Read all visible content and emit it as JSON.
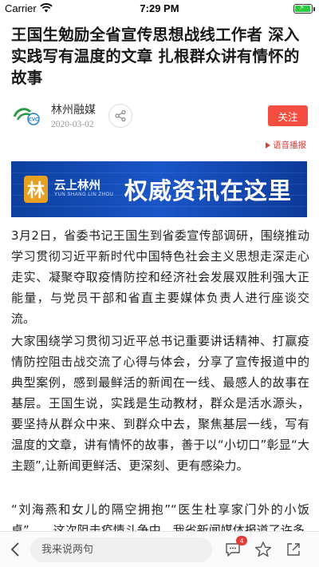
{
  "status_bar": {
    "carrier": "Carrier",
    "time": "7:29 PM"
  },
  "article": {
    "title": "王国生勉励全省宣传思想战线工作者 深入实践写有温度的文章 扎根群众讲有情怀的故事",
    "source": {
      "name": "林州融媒",
      "date": "2020-03-02",
      "logo_text": "CVC"
    },
    "follow_label": "关注",
    "audio_label": "语音播报",
    "banner": {
      "brand": "云上林州",
      "brand_sub": "YUN SHANG LIN ZHOU",
      "slogan": "权威资讯在这里",
      "emblem": "林"
    },
    "paragraphs": [
      "3月2日，省委书记王国生到省委宣传部调研，围绕推动学习贯彻习近平新时代中国特色社会主义思想走深走心走实、凝聚夺取疫情防控和经济社会发展双胜利强大正能量，与党员干部和省直主要媒体负责人进行座谈交流。",
      "大家围绕学习贯彻习近平总书记重要讲话精神、打赢疫情防控阻击战交流了心得与体会，分享了宣传报道中的典型案例，感到最鲜活的新闻在一线、最感人的故事在基层。王国生说，实践是生动教材，群众是活水源头，要坚持从群众中来、到群众中去，聚焦基层一线，写有温度的文章，讲有情怀的故事，善于以“小切口”彰显“大主题”,让新闻更鲜活、更深刻、更有感染力。",
      "“刘海燕和女儿的隔空拥抱”“医生杜享家门外的小饭桌”……这次阻击疫情斗争中，我省新闻媒体报道了许多"
    ]
  },
  "bottom_bar": {
    "comment_placeholder": "我来说两句",
    "comment_count": "4"
  },
  "colors": {
    "accent": "#f34e3f",
    "audio": "#d9403a",
    "banner_blue": "#1a56c8",
    "battery": "#2ecc40"
  },
  "icons": {
    "wifi": "wifi-icon",
    "battery": "battery-icon",
    "share": "share-icon",
    "back": "chevron-left-icon",
    "comment": "comment-icon",
    "star": "star-icon",
    "forward": "share-out-icon"
  }
}
